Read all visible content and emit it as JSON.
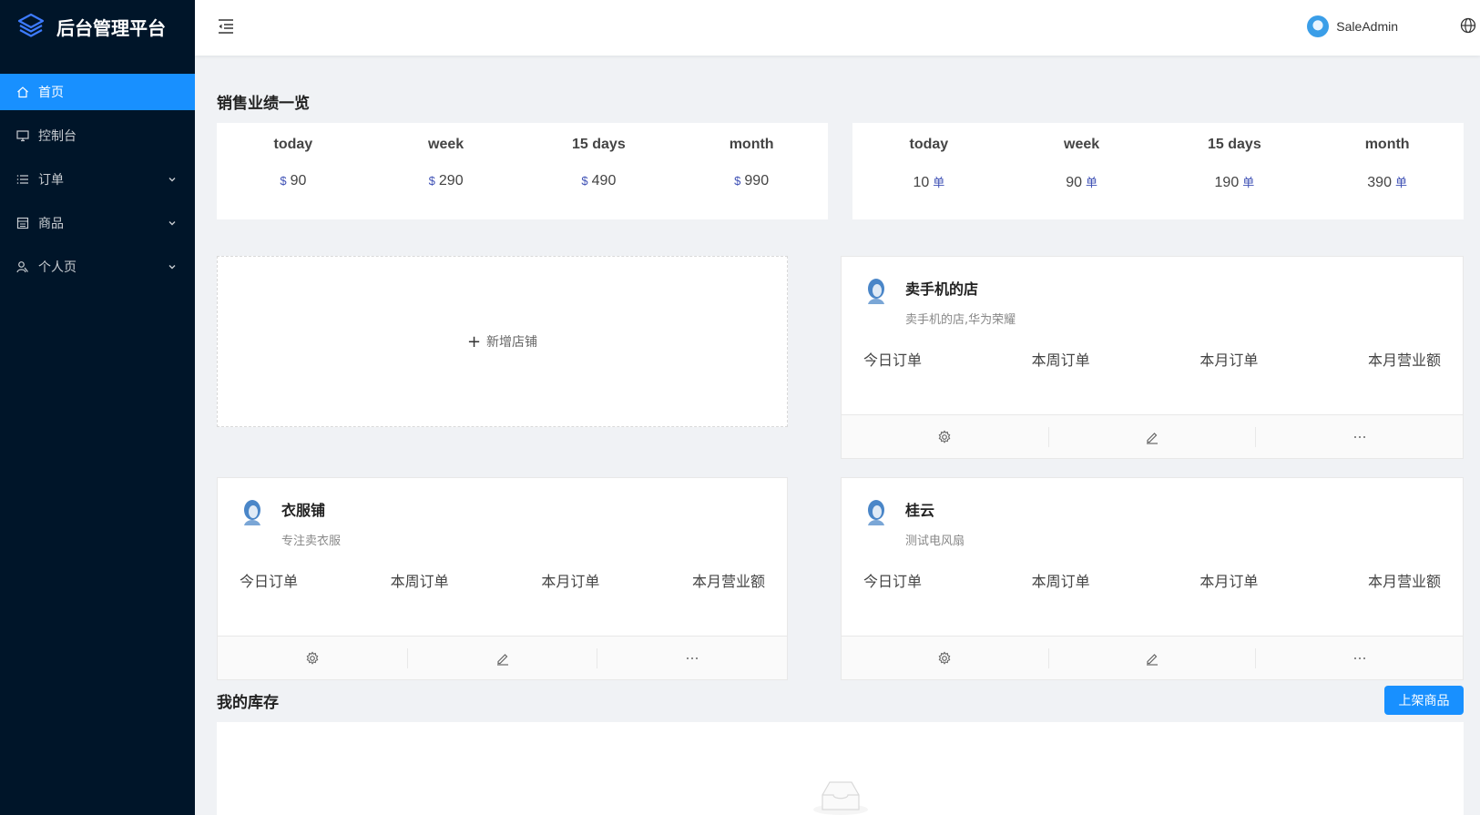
{
  "app": {
    "title": "后台管理平台"
  },
  "sidebar": {
    "items": [
      {
        "label": "首页",
        "icon": "home-icon",
        "active": true,
        "expandable": false
      },
      {
        "label": "控制台",
        "icon": "desktop-icon",
        "active": false,
        "expandable": false
      },
      {
        "label": "订单",
        "icon": "list-icon",
        "active": false,
        "expandable": true
      },
      {
        "label": "商品",
        "icon": "shop-icon",
        "active": false,
        "expandable": true
      },
      {
        "label": "个人页",
        "icon": "user-icon",
        "active": false,
        "expandable": true
      }
    ]
  },
  "header": {
    "username": "SaleAdmin",
    "icons": [
      "menu-fold-icon",
      "avatar",
      "globe-icon"
    ]
  },
  "sales": {
    "title": "销售业绩一览",
    "revenue": {
      "currency": "$",
      "items": [
        {
          "label": "today",
          "value": "90"
        },
        {
          "label": "week",
          "value": "290"
        },
        {
          "label": "15 days",
          "value": "490"
        },
        {
          "label": "month",
          "value": "990"
        }
      ]
    },
    "orders": {
      "unit": "单",
      "items": [
        {
          "label": "today",
          "value": "10"
        },
        {
          "label": "week",
          "value": "90"
        },
        {
          "label": "15 days",
          "value": "190"
        },
        {
          "label": "month",
          "value": "390"
        }
      ]
    }
  },
  "shops": {
    "add_label": "新增店铺",
    "stat_labels": [
      "今日订单",
      "本周订单",
      "本月订单",
      "本月营业额"
    ],
    "items": [
      {
        "name": "卖手机的店",
        "desc": "卖手机的店,华为荣耀"
      },
      {
        "name": "衣服铺",
        "desc": "专注卖衣服"
      },
      {
        "name": "桂云",
        "desc": "测试电风扇"
      }
    ]
  },
  "inventory": {
    "title": "我的库存",
    "publish_button": "上架商品"
  },
  "colors": {
    "sidebar_bg": "#001529",
    "primary": "#1890ff",
    "accent_text": "#3f51b5"
  }
}
